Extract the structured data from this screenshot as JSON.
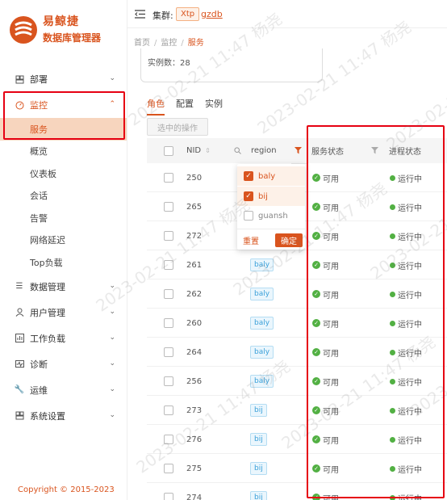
{
  "app": {
    "title": "易鲸捷",
    "subtitle": "数据库管理器",
    "brand_color": "#d9541e"
  },
  "header": {
    "cluster_label": "集群:",
    "cluster_type": "Xtp",
    "cluster_name": "gzdb"
  },
  "breadcrumb": {
    "items": [
      "首页",
      "监控",
      "服务"
    ]
  },
  "sidebar": {
    "items": [
      {
        "label": "部署",
        "icon": "deploy-icon"
      },
      {
        "label": "监控",
        "icon": "gauge-icon",
        "active": true
      },
      {
        "label": "数据管理",
        "icon": "list-icon"
      },
      {
        "label": "用户管理",
        "icon": "user-icon"
      },
      {
        "label": "工作负载",
        "icon": "workload-icon"
      },
      {
        "label": "诊断",
        "icon": "diagnose-icon"
      },
      {
        "label": "运维",
        "icon": "wrench-icon"
      },
      {
        "label": "系统设置",
        "icon": "settings-icon"
      }
    ],
    "monitor_sub": [
      "服务",
      "概览",
      "仪表板",
      "会话",
      "告警",
      "网络延迟",
      "Top负载"
    ],
    "copyright": "Copyright © 2015-2023"
  },
  "main": {
    "instance_count": "实例数：28",
    "tabs": [
      "角色",
      "配置",
      "实例"
    ],
    "batch_button": "选中的操作",
    "columns": {
      "nid": "NID",
      "region": "region",
      "service_status": "服务状态",
      "process_status": "进程状态"
    },
    "rows": [
      {
        "nid": "250",
        "region": "",
        "service": "可用",
        "process": "运行中"
      },
      {
        "nid": "265",
        "region": "",
        "service": "可用",
        "process": "运行中"
      },
      {
        "nid": "272",
        "region": "",
        "service": "可用",
        "process": "运行中"
      },
      {
        "nid": "261",
        "region": "baly",
        "service": "可用",
        "process": "运行中"
      },
      {
        "nid": "262",
        "region": "baly",
        "service": "可用",
        "process": "运行中"
      },
      {
        "nid": "260",
        "region": "baly",
        "service": "可用",
        "process": "运行中"
      },
      {
        "nid": "264",
        "region": "baly",
        "service": "可用",
        "process": "运行中"
      },
      {
        "nid": "256",
        "region": "baly",
        "service": "可用",
        "process": "运行中"
      },
      {
        "nid": "273",
        "region": "bij",
        "service": "可用",
        "process": "运行中"
      },
      {
        "nid": "276",
        "region": "bij",
        "service": "可用",
        "process": "运行中"
      },
      {
        "nid": "275",
        "region": "bij",
        "service": "可用",
        "process": "运行中"
      },
      {
        "nid": "274",
        "region": "bij",
        "service": "可用",
        "process": "运行中"
      }
    ]
  },
  "region_filter": {
    "options": [
      {
        "label": "baly",
        "checked": true
      },
      {
        "label": "bij",
        "checked": true
      },
      {
        "label": "guansh",
        "checked": false
      }
    ],
    "reset_label": "重置",
    "confirm_label": "确定"
  },
  "watermark": {
    "date": "2023-02-21",
    "time": "11:47",
    "name": "杨尧"
  }
}
